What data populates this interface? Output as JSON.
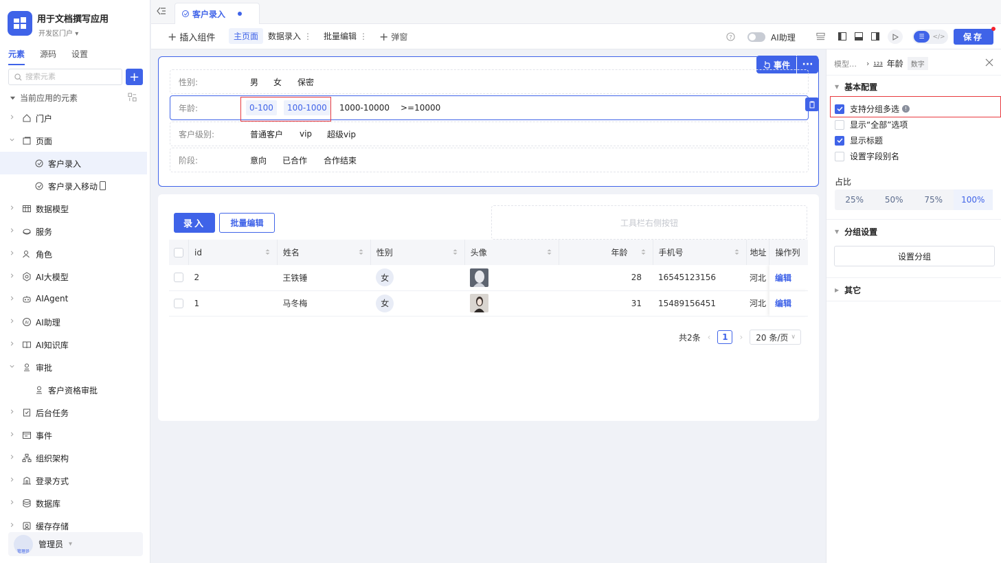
{
  "app": {
    "title": "用于文档撰写应用",
    "env": "开发区门户"
  },
  "sidebar": {
    "tabs": [
      "元素",
      "源码",
      "设置"
    ],
    "search_placeholder": "搜索元素",
    "tree_header": "当前应用的元素",
    "items": [
      {
        "label": "门户",
        "icon": "home-icon",
        "depth": 0
      },
      {
        "label": "页面",
        "icon": "page-icon",
        "depth": 0,
        "expanded": true
      },
      {
        "label": "客户录入",
        "icon": "form-page-icon",
        "depth": 1,
        "selected": true
      },
      {
        "label": "客户录入移动",
        "icon": "form-page-icon",
        "depth": 1,
        "mobile": true
      },
      {
        "label": "数据模型",
        "icon": "table-icon",
        "depth": 0
      },
      {
        "label": "服务",
        "icon": "service-icon",
        "depth": 0
      },
      {
        "label": "角色",
        "icon": "role-icon",
        "depth": 0
      },
      {
        "label": "AI大模型",
        "icon": "ai-model-icon",
        "depth": 0
      },
      {
        "label": "AIAgent",
        "icon": "robot-icon",
        "depth": 0
      },
      {
        "label": "AI助理",
        "icon": "ai-assistant-icon",
        "depth": 0
      },
      {
        "label": "AI知识库",
        "icon": "book-icon",
        "depth": 0
      },
      {
        "label": "审批",
        "icon": "approval-icon",
        "depth": 0,
        "expanded": true
      },
      {
        "label": "客户资格审批",
        "icon": "approval-icon",
        "depth": 1
      },
      {
        "label": "后台任务",
        "icon": "task-icon",
        "depth": 0
      },
      {
        "label": "事件",
        "icon": "event-icon",
        "depth": 0
      },
      {
        "label": "组织架构",
        "icon": "org-icon",
        "depth": 0
      },
      {
        "label": "登录方式",
        "icon": "login-icon",
        "depth": 0
      },
      {
        "label": "数据库",
        "icon": "database-icon",
        "depth": 0
      },
      {
        "label": "缓存存储",
        "icon": "cache-icon",
        "depth": 0
      }
    ],
    "user": {
      "name": "管理员",
      "avatar_text": "管理员"
    }
  },
  "tabbar": {
    "active_tab": "客户录入"
  },
  "toolbar": {
    "insert": "插入组件",
    "main_page": "主页面",
    "data_entry": "数据录入",
    "batch_edit": "批量编辑",
    "popup": "弹窗",
    "ai_assistant": "AI助理",
    "save": "保存"
  },
  "filter": {
    "event_button": "事件",
    "rows": [
      {
        "label": "性别:",
        "options": [
          "男",
          "女",
          "保密"
        ]
      },
      {
        "label": "年龄:",
        "options": [
          "0-100",
          "100-1000",
          "1000-10000",
          ">=10000"
        ]
      },
      {
        "label": "客户级别:",
        "options": [
          "普通客户",
          "vip",
          "超级vip"
        ]
      },
      {
        "label": "阶段:",
        "options": [
          "意向",
          "已合作",
          "合作结束"
        ]
      }
    ]
  },
  "table": {
    "add_button": "录入",
    "batch_button": "批量编辑",
    "toolbar_right_placeholder": "工具栏右侧按钮",
    "columns": [
      "id",
      "姓名",
      "性别",
      "头像",
      "年龄",
      "手机号",
      "地址",
      "操作列"
    ],
    "rows": [
      {
        "id": "2",
        "name": "王铁锤",
        "gender": "女",
        "age": "28",
        "phone": "16545123156",
        "addr": "河北",
        "action": "编辑"
      },
      {
        "id": "1",
        "name": "马冬梅",
        "gender": "女",
        "age": "31",
        "phone": "15489156451",
        "addr": "河北",
        "action": "编辑"
      }
    ],
    "total": "共2条",
    "page": "1",
    "page_size": "20 条/页"
  },
  "panel": {
    "breadcrumb_model": "模型…",
    "field_type_icon": "123",
    "field_name": "年龄",
    "field_type": "数字",
    "basic_section": "基本配置",
    "options": [
      {
        "label": "支持分组多选",
        "checked": true,
        "info": true
      },
      {
        "label": "显示“全部”选项",
        "checked": false
      },
      {
        "label": "显示标题",
        "checked": true
      },
      {
        "label": "设置字段别名",
        "checked": false
      }
    ],
    "ratio_label": "占比",
    "ratios": [
      "25%",
      "50%",
      "75%",
      "100%"
    ],
    "ratio_selected": "100%",
    "group_section": "分组设置",
    "group_button": "设置分组",
    "other_section": "其它"
  },
  "colors": {
    "accent": "#3f63e8",
    "highlight": "#e8383d"
  }
}
